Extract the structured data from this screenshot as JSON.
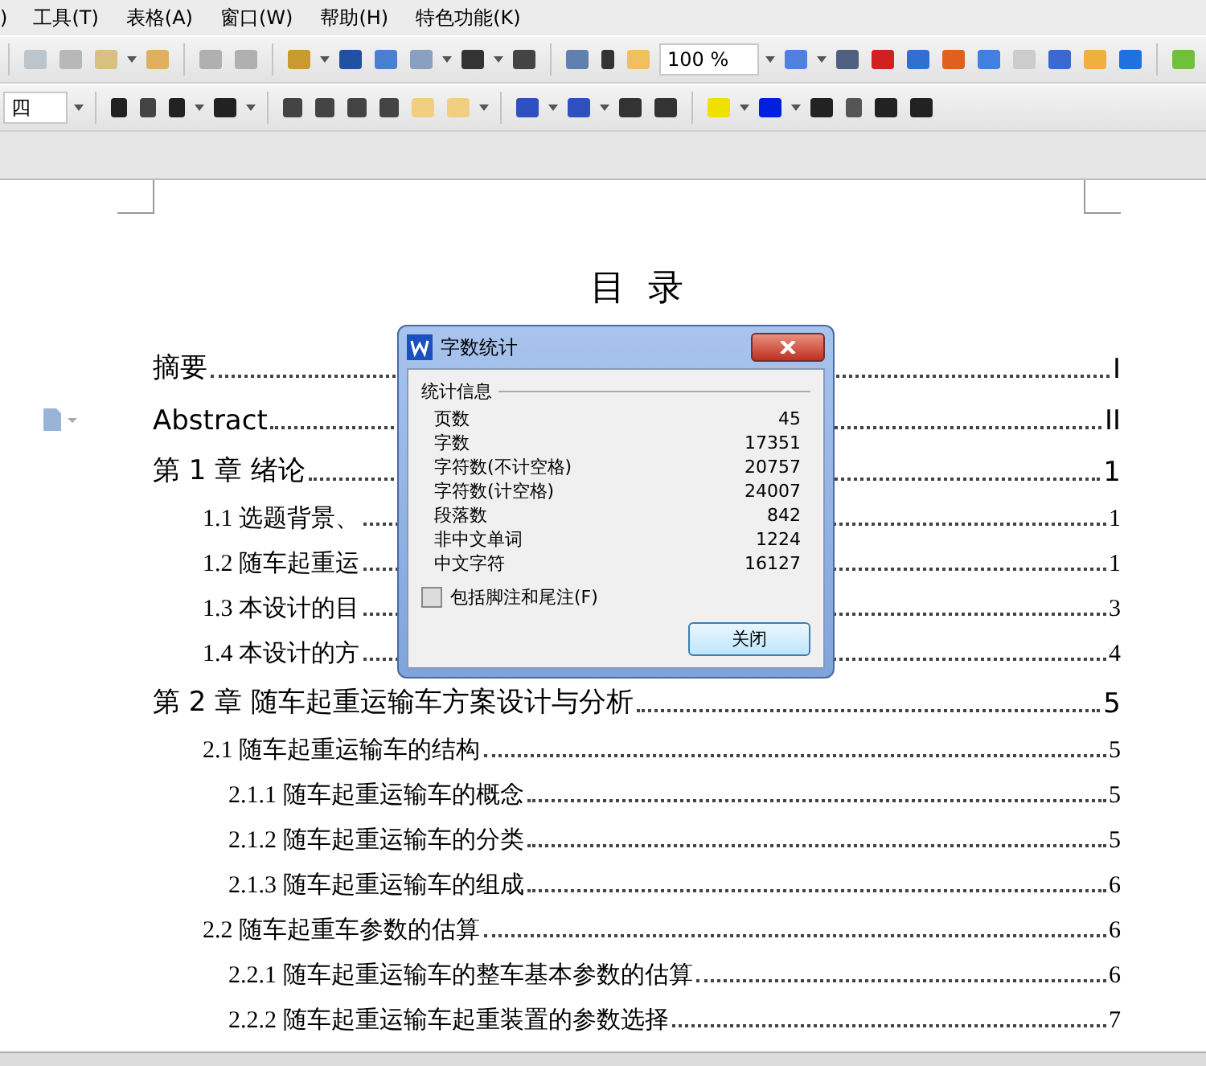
{
  "menu": [
    {
      "label": ")"
    },
    {
      "label": "工具(T)"
    },
    {
      "label": "表格(A)"
    },
    {
      "label": "窗口(W)"
    },
    {
      "label": "帮助(H)"
    },
    {
      "label": "特色功能(K)"
    }
  ],
  "zoom": "100 %",
  "font_size": "四",
  "toc_title": "目  录",
  "toc": [
    {
      "title": "摘要",
      "page": "I"
    },
    {
      "title": "Abstract ",
      "page": "II"
    },
    {
      "title": "第 1 章  绪论",
      "page": "1",
      "children": [
        {
          "title": "1.1 选题背景、",
          "page": "1"
        },
        {
          "title": "1.2  随车起重运",
          "page": "1"
        },
        {
          "title": "1.3 本设计的目",
          "page": "3"
        },
        {
          "title": "1.4  本设计的方",
          "page": "4"
        }
      ]
    },
    {
      "title": "第 2 章  随车起重运输车方案设计与分析",
      "page": "5",
      "children": [
        {
          "title": "2.1  随车起重运输车的结构",
          "page": "5",
          "children": [
            {
              "title": "2.1.1 随车起重运输车的概念",
              "page": "5"
            },
            {
              "title": "2.1.2 随车起重运输车的分类",
              "page": "5"
            },
            {
              "title": "2.1.3 随车起重运输车的组成",
              "page": "6"
            }
          ]
        },
        {
          "title": "2.2 随车起重车参数的估算",
          "page": "6",
          "children": [
            {
              "title": "2.2.1 随车起重运输车的整车基本参数的估算",
              "page": "6"
            },
            {
              "title": "2.2.2 随车起重运输车起重装置的参数选择",
              "page": "7"
            }
          ]
        }
      ]
    }
  ],
  "dialog": {
    "title": "字数统计",
    "group": "统计信息",
    "stats": [
      {
        "label": "页数",
        "value": "45"
      },
      {
        "label": "字数",
        "value": "17351"
      },
      {
        "label": "字符数(不计空格)",
        "value": "20757"
      },
      {
        "label": "字符数(计空格)",
        "value": "24007"
      },
      {
        "label": "段落数",
        "value": "842"
      },
      {
        "label": "非中文单词",
        "value": "1224"
      },
      {
        "label": "中文字符",
        "value": "16127"
      }
    ],
    "checkbox": {
      "label": "包括脚注和尾注(F)",
      "checked": false
    },
    "button": "关闭"
  }
}
